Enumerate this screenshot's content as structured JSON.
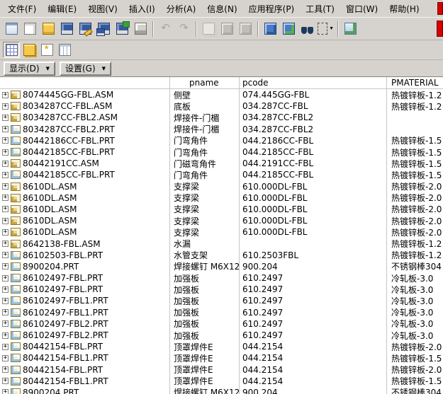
{
  "colors": {
    "window_bg": "#d6d3ce",
    "panel_bg": "#ffffff",
    "grid_line": "#c6c6c6",
    "text": "#000000",
    "accent_red": "#d40000",
    "toolbar_icon_blue": "#35599f",
    "toolbar_icon_yellow": "#f6c94e"
  },
  "menubar": {
    "items": [
      {
        "id": "file",
        "label": "文件(F)"
      },
      {
        "id": "edit",
        "label": "编辑(E)"
      },
      {
        "id": "view",
        "label": "视图(V)"
      },
      {
        "id": "insert",
        "label": "插入(I)"
      },
      {
        "id": "analysis",
        "label": "分析(A)"
      },
      {
        "id": "info",
        "label": "信息(N)"
      },
      {
        "id": "applications",
        "label": "应用程序(P)"
      },
      {
        "id": "tools",
        "label": "工具(T)"
      },
      {
        "id": "window",
        "label": "窗口(W)"
      },
      {
        "id": "help",
        "label": "帮助(H)"
      }
    ]
  },
  "toolbar_main": {
    "buttons": [
      {
        "id": "new-object"
      },
      {
        "id": "new-file"
      },
      {
        "id": "open"
      },
      {
        "id": "save"
      },
      {
        "id": "save-as"
      },
      {
        "id": "backup"
      },
      {
        "id": "save-copy"
      },
      {
        "id": "print"
      },
      {
        "sep": true
      },
      {
        "id": "undo",
        "glyph": "↶",
        "disabled": true
      },
      {
        "id": "redo",
        "glyph": "↷",
        "disabled": true
      },
      {
        "sep": true
      },
      {
        "id": "copy",
        "disabled": true
      },
      {
        "id": "paste",
        "disabled": true
      },
      {
        "id": "paste-special",
        "disabled": true
      },
      {
        "sep": true
      },
      {
        "id": "regenerate"
      },
      {
        "id": "custom-regenerate"
      },
      {
        "id": "find"
      },
      {
        "id": "select-filter",
        "caret": true
      },
      {
        "sep": true
      },
      {
        "id": "repaint"
      }
    ]
  },
  "toolbar_tree": {
    "buttons": [
      {
        "id": "model-tree-toggle",
        "pressed": true
      },
      {
        "id": "folder-browser"
      },
      {
        "id": "favorites"
      },
      {
        "id": "layer-columns"
      }
    ]
  },
  "tree_controls": {
    "show_label": "显示(D)",
    "settings_label": "设置(G)",
    "caret_glyph": "▼"
  },
  "grid": {
    "expander_glyph": "+",
    "columns": [
      {
        "id": "pname",
        "label": "pname"
      },
      {
        "id": "pcode",
        "label": "pcode"
      },
      {
        "id": "pmaterial",
        "label": "PMATERIAL"
      }
    ],
    "rows": [
      {
        "file": "8074445GG-FBL.ASM",
        "icon": "asm",
        "pname": "侧壁",
        "pcode": "074.445GG-FBL",
        "pmaterial": "热镀锌板-1.2"
      },
      {
        "file": "8034287CC-FBL.ASM",
        "icon": "asm",
        "pname": "底板",
        "pcode": "034.287CC-FBL",
        "pmaterial": "热镀锌板-1.2"
      },
      {
        "file": "8034287CC-FBL2.ASM",
        "icon": "asm",
        "pname": "焊接件-门楣",
        "pcode": "034.287CC-FBL2",
        "pmaterial": ""
      },
      {
        "file": "8034287CC-FBL2.PRT",
        "icon": "prt",
        "pname": "焊接件-门楣",
        "pcode": "034.287CC-FBL2",
        "pmaterial": ""
      },
      {
        "file": "80442186CC-FBL.PRT",
        "icon": "prt",
        "pname": "门弯角件",
        "pcode": "044.2186CC-FBL",
        "pmaterial": "热镀锌板-1.5"
      },
      {
        "file": "80442185CC-FBL.PRT",
        "icon": "prt",
        "pname": "门弯角件",
        "pcode": "044.2185CC-FBL",
        "pmaterial": "热镀锌板-1.5"
      },
      {
        "file": "80442191CC.ASM",
        "icon": "asm",
        "pname": "门磁弯角件",
        "pcode": "044.2191CC-FBL",
        "pmaterial": "热镀锌板-1.5"
      },
      {
        "file": "80442185CC-FBL.PRT",
        "icon": "prt",
        "pname": "门弯角件",
        "pcode": "044.2185CC-FBL",
        "pmaterial": "热镀锌板-1.5"
      },
      {
        "file": "8610DL.ASM",
        "icon": "asm",
        "pname": "支撑梁",
        "pcode": "610.000DL-FBL",
        "pmaterial": "热镀锌板-2.0"
      },
      {
        "file": "8610DL.ASM",
        "icon": "asm",
        "pname": "支撑梁",
        "pcode": "610.000DL-FBL",
        "pmaterial": "热镀锌板-2.0"
      },
      {
        "file": "8610DL.ASM",
        "icon": "asm",
        "pname": "支撑梁",
        "pcode": "610.000DL-FBL",
        "pmaterial": "热镀锌板-2.0"
      },
      {
        "file": "8610DL.ASM",
        "icon": "asm",
        "pname": "支撑梁",
        "pcode": "610.000DL-FBL",
        "pmaterial": "热镀锌板-2.0"
      },
      {
        "file": "8610DL.ASM",
        "icon": "asm",
        "pname": "支撑梁",
        "pcode": "610.000DL-FBL",
        "pmaterial": "热镀锌板-2.0"
      },
      {
        "file": "8642138-FBL.ASM",
        "icon": "asm",
        "pname": "水漏",
        "pcode": "",
        "pmaterial": "热镀锌板-1.2"
      },
      {
        "file": "86102503-FBL.PRT",
        "icon": "prt",
        "pname": "水管支架",
        "pcode": "610.2503FBL",
        "pmaterial": "热镀锌板-1.2"
      },
      {
        "file": "8900204.PRT",
        "icon": "prt",
        "pname": "焊接螺钉 M6X12",
        "pcode": "900.204",
        "pmaterial": "不锈钢棒304"
      },
      {
        "file": "86102497-FBL.PRT",
        "icon": "prt",
        "pname": "加强板",
        "pcode": "610.2497",
        "pmaterial": "冷轧板-3.0"
      },
      {
        "file": "86102497-FBL.PRT",
        "icon": "prt",
        "pname": "加强板",
        "pcode": "610.2497",
        "pmaterial": "冷轧板-3.0"
      },
      {
        "file": "86102497-FBL1.PRT",
        "icon": "prt",
        "pname": "加强板",
        "pcode": "610.2497",
        "pmaterial": "冷轧板-3.0"
      },
      {
        "file": "86102497-FBL1.PRT",
        "icon": "prt",
        "pname": "加强板",
        "pcode": "610.2497",
        "pmaterial": "冷轧板-3.0"
      },
      {
        "file": "86102497-FBL2.PRT",
        "icon": "prt",
        "pname": "加强板",
        "pcode": "610.2497",
        "pmaterial": "冷轧板-3.0"
      },
      {
        "file": "86102497-FBL2.PRT",
        "icon": "prt",
        "pname": "加强板",
        "pcode": "610.2497",
        "pmaterial": "冷轧板-3.0"
      },
      {
        "file": "80442154-FBL.PRT",
        "icon": "prt",
        "pname": "顶罩焊件E",
        "pcode": "044.2154",
        "pmaterial": "热镀锌板-2.0"
      },
      {
        "file": "80442154-FBL1.PRT",
        "icon": "prt",
        "pname": "顶罩焊件E",
        "pcode": "044.2154",
        "pmaterial": "热镀锌板-1.5"
      },
      {
        "file": "80442154-FBL.PRT",
        "icon": "prt",
        "pname": "顶罩焊件E",
        "pcode": "044.2154",
        "pmaterial": "热镀锌板-2.0"
      },
      {
        "file": "80442154-FBL1.PRT",
        "icon": "prt",
        "pname": "顶罩焊件E",
        "pcode": "044.2154",
        "pmaterial": "热镀锌板-1.5"
      },
      {
        "file": "8900204.PRT",
        "icon": "prt",
        "pname": "焊接螺钉 M6X12",
        "pcode": "900.204",
        "pmaterial": "不锈钢棒304"
      }
    ]
  }
}
